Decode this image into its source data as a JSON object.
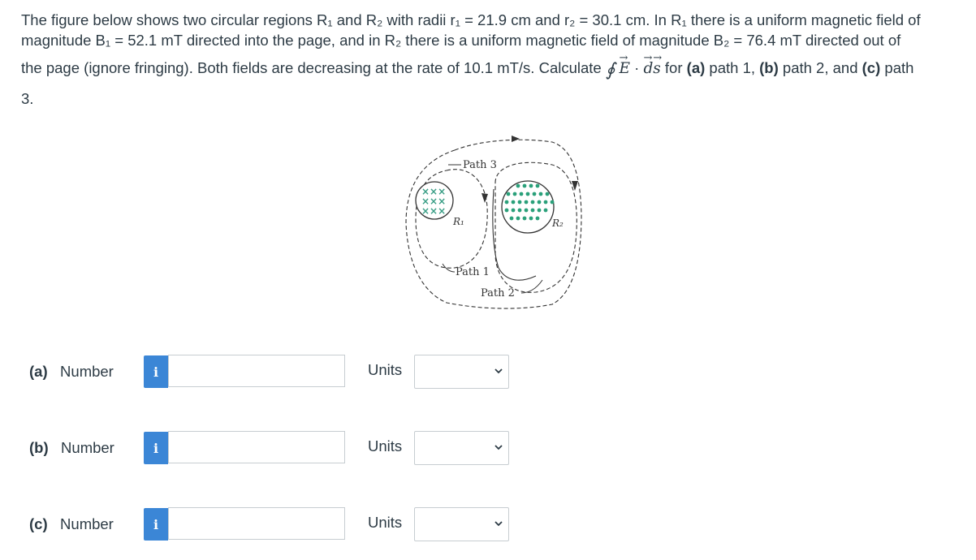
{
  "question": {
    "line1": "The figure below shows two circular regions R₁ and R₂ with radii r₁ = 21.9 cm and r₂ = 30.1 cm. In R₁ there is a uniform magnetic field of",
    "line2": "magnitude B₁ = 52.1 mT directed into the page, and in R₂ there is a uniform magnetic field of magnitude B₂ = 76.4 mT directed out of",
    "line3_prefix": "the page (ignore fringing). Both fields are decreasing at the rate of 10.1 mT/s. Calculate",
    "integral_symbol": "∮",
    "vec_E": "E",
    "dot": "·",
    "d": "d",
    "vec_s": "s",
    "line3_for": "for",
    "part_a_tag": "(a)",
    "part_a_text": "path 1,",
    "part_b_tag": "(b)",
    "part_b_text": "path 2, and",
    "part_c_tag": "(c)",
    "part_c_text": "path",
    "line4": "3."
  },
  "figure": {
    "path3_label": "Path 3",
    "path1_label": "Path 1",
    "path2_label": "Path 2",
    "r1_label": "R₁",
    "r2_label": "R₂",
    "field_in_color": "#3a9e86",
    "field_out_color": "#2aa07a"
  },
  "answers": [
    {
      "tag": "(a)",
      "label": "Number",
      "info_icon": "i",
      "value": "",
      "units_label": "Units",
      "units_value": ""
    },
    {
      "tag": "(b)",
      "label": "Number",
      "info_icon": "i",
      "value": "",
      "units_label": "Units",
      "units_value": ""
    },
    {
      "tag": "(c)",
      "label": "Number",
      "info_icon": "i",
      "value": "",
      "units_label": "Units",
      "units_value": ""
    }
  ],
  "colors": {
    "info_button": "#3b86d6",
    "text": "#2d3b45",
    "input_border": "#c7cdd1"
  }
}
